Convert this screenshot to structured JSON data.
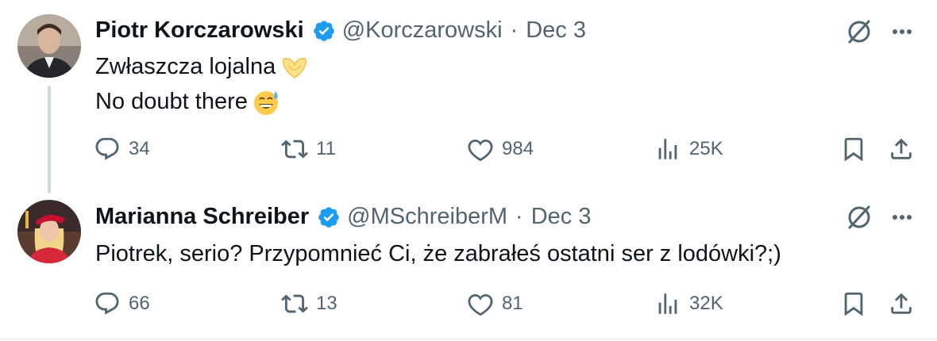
{
  "tweets": [
    {
      "author_name": "Piotr Korczarowski",
      "handle": "@Korczarowski",
      "separator": "·",
      "date": "Dec 3",
      "lines": [
        "Zwłaszcza lojalna",
        "No doubt there"
      ],
      "emoji": [
        "heart-hands-emoji",
        "grinning-sweat-emoji"
      ],
      "stats": {
        "replies": "34",
        "reposts": "11",
        "likes": "984",
        "views": "25K"
      }
    },
    {
      "author_name": "Marianna Schreiber",
      "handle": "@MSchreiberM",
      "separator": "·",
      "date": "Dec 3",
      "lines": [
        "Piotrek, serio? Przypomnieć Ci, że zabrałeś ostatni ser z lodówki?;)"
      ],
      "stats": {
        "replies": "66",
        "reposts": "13",
        "likes": "81",
        "views": "32K"
      }
    }
  ],
  "colors": {
    "verified": "#1d9bf0",
    "secondary_text": "#536471",
    "thread_line": "#cfd9de"
  }
}
